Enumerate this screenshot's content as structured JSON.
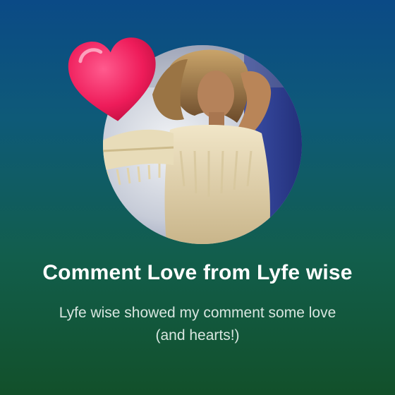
{
  "notification": {
    "title": "Comment Love from Lyfe wise",
    "subtitle": "Lyfe wise showed my comment some love (and hearts!)"
  },
  "avatar": {
    "icon": "profile-photo"
  },
  "badge": {
    "icon": "heart-icon",
    "color": "#ee1c5a"
  },
  "colors": {
    "background_top": "#0b4a86",
    "background_bottom": "#12502a"
  }
}
